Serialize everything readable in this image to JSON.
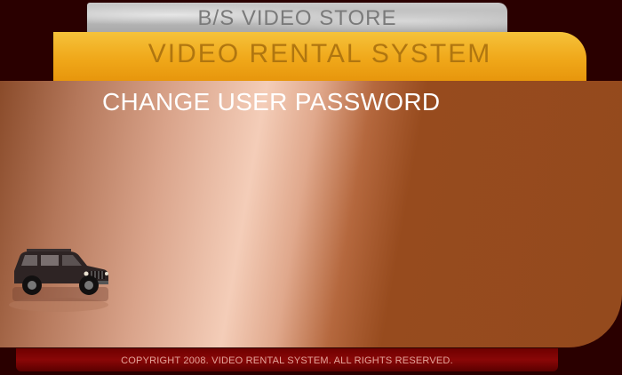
{
  "header": {
    "store_name": "B/S VIDEO STORE",
    "system_name": "VIDEO RENTAL SYSTEM"
  },
  "main": {
    "heading": "CHANGE USER PASSWORD",
    "image": "suv-vehicle-graphic"
  },
  "footer": {
    "copyright": "COPYRIGHT 2008. VIDEO RENTAL SYSTEM. ALL RIGHTS  RESERVED."
  },
  "colors": {
    "background": "#2a0000",
    "store_banner": "#b8b8b8",
    "system_banner": "#f0a81a",
    "panel_dark": "#944a1d",
    "panel_highlight": "#f4cdb8",
    "footer": "#8a0707"
  }
}
